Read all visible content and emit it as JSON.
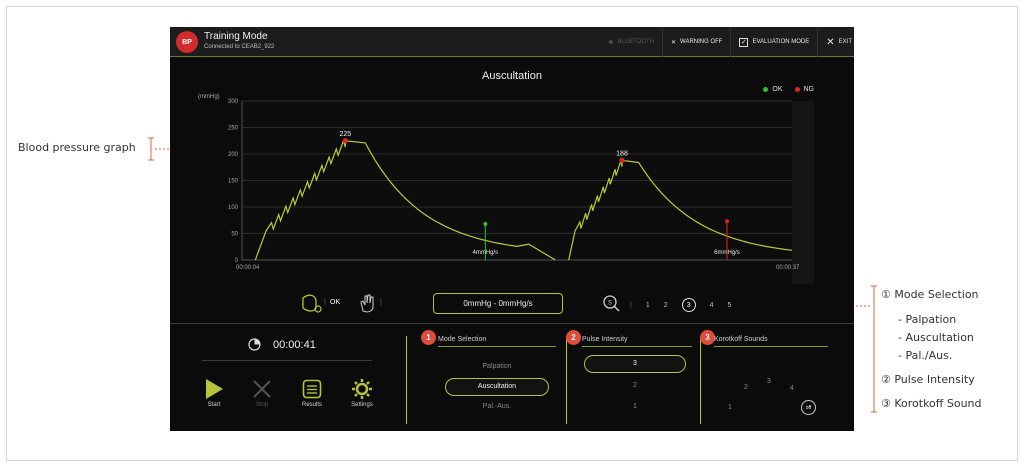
{
  "app": {
    "logo_text": "BP",
    "title": "Training Mode",
    "subtitle": "Connected to CEAB2_922"
  },
  "toolbar": {
    "bluetooth": "BLUETOOTH",
    "warning": "WARNING OFF",
    "evaluation": "EVALUATION MODE",
    "exit": "EXIT"
  },
  "graph": {
    "title": "Auscultation",
    "unit": "(mmHg)",
    "legend_ok": "OK",
    "legend_ng": "NG",
    "time_start": "00:00:04",
    "time_end": "00:00:37",
    "peak1_label": "225",
    "peak2_label": "188",
    "rate1_label": "4mmHg/s",
    "rate2_label": "6mmHg/s",
    "colors": {
      "ok": "#2fc12f",
      "ng": "#e02323",
      "line": "#b8cc3a",
      "grid": "#2c2c2c"
    }
  },
  "chart_data": {
    "type": "line",
    "title": "Auscultation",
    "ylabel": "(mmHg)",
    "ylim": [
      0,
      300
    ],
    "yticks": [
      0,
      50,
      100,
      150,
      200,
      250,
      300
    ],
    "grid": true,
    "legend": [
      "OK",
      "NG"
    ],
    "series": [
      {
        "name": "",
        "x": [
          0,
          1.8,
          3.5,
          6.2,
          7.5,
          12,
          16,
          19
        ],
        "values": [
          0,
          60,
          160,
          225,
          220,
          120,
          50,
          0
        ]
      },
      {
        "name": "",
        "x": [
          19.6,
          20.6,
          22.8,
          23.8,
          27,
          31.5
        ],
        "values": [
          0,
          50,
          188,
          192,
          120,
          28
        ]
      }
    ],
    "annotations": [
      {
        "x": 6.2,
        "value": 225,
        "label": "225",
        "status": "NG"
      },
      {
        "x": 14.6,
        "value": 68,
        "label": "4mmHg/s",
        "status": "OK"
      },
      {
        "x": 22.8,
        "value": 188,
        "label": "188",
        "status": "NG"
      },
      {
        "x": 29.1,
        "value": 73,
        "label": "6mmHg/s",
        "status": "NG"
      }
    ]
  },
  "controls": {
    "ok_label": "OK",
    "rate_display": "0mmHg - 0mmHg/s",
    "zoom_options": [
      "1",
      "2",
      "3",
      "4",
      "5"
    ],
    "zoom_selected": "3"
  },
  "bottom": {
    "timer": "00:00:41",
    "buttons": {
      "start": "Start",
      "stop": "Stop",
      "results": "Results",
      "settings": "Settings"
    },
    "mode_panel": {
      "badge": "1",
      "title": "Mode Selection",
      "options": [
        "Palpation",
        "Auscultation",
        "Pal.-Aus."
      ],
      "selected": "Auscultation"
    },
    "pulse_panel": {
      "badge": "2",
      "title": "Pulse Intensity",
      "options": [
        "3",
        "2",
        "1"
      ],
      "selected": "3"
    },
    "korotkoff_panel": {
      "badge": "3",
      "title": "Korotkoff Sounds",
      "dial": [
        "1",
        "2",
        "3",
        "4"
      ],
      "dial_selected": "off"
    }
  },
  "annotations": {
    "bp_graph": "Blood pressure graph",
    "mode": "① Mode Selection",
    "mode_items": [
      "- Palpation",
      "- Auscultation",
      "- Pal./Aus."
    ],
    "pulse": "② Pulse Intensity",
    "korotkoff": "③ Korotkoff Sound"
  }
}
